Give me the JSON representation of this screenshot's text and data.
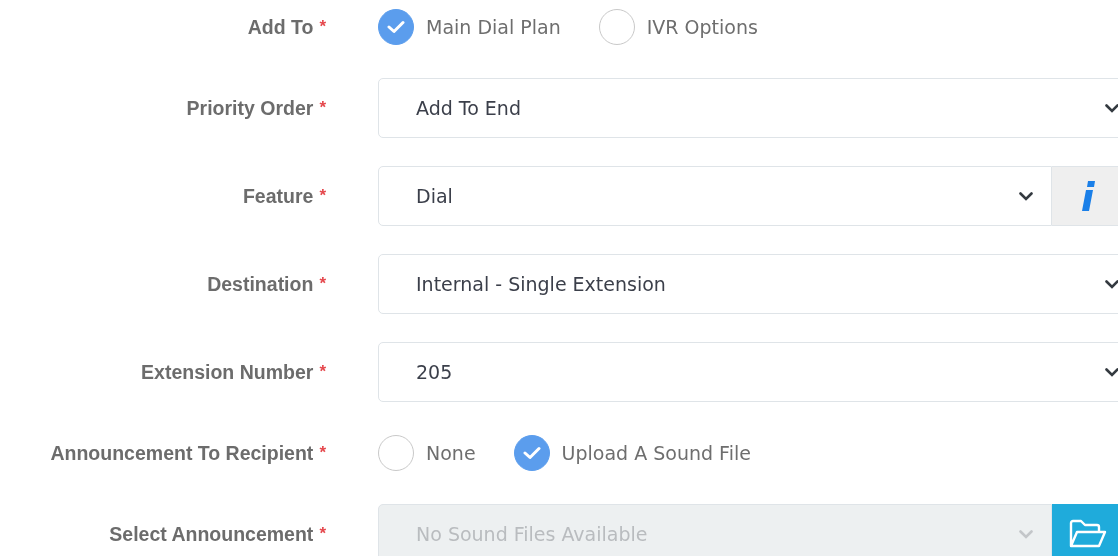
{
  "form": {
    "rows": [
      {
        "kind": "radio",
        "label": "Add To",
        "required_mark": "*",
        "options": [
          {
            "label": "Main Dial Plan",
            "selected": true
          },
          {
            "label": "IVR Options",
            "selected": false
          }
        ]
      },
      {
        "kind": "select",
        "label": "Priority Order",
        "required_mark": "*",
        "value": "Add To End",
        "disabled": false
      },
      {
        "kind": "select_info",
        "label": "Feature",
        "required_mark": "*",
        "value": "Dial",
        "disabled": false
      },
      {
        "kind": "select",
        "label": "Destination",
        "required_mark": "*",
        "value": "Internal - Single Extension",
        "disabled": false
      },
      {
        "kind": "select",
        "label": "Extension Number",
        "required_mark": "*",
        "value": "205",
        "disabled": false
      },
      {
        "kind": "radio",
        "label": "Announcement To Recipient",
        "required_mark": "*",
        "options": [
          {
            "label": "None",
            "selected": false
          },
          {
            "label": "Upload A Sound File",
            "selected": true
          }
        ]
      },
      {
        "kind": "select_file",
        "label": "Select Announcement",
        "required_mark": "*",
        "value": "No Sound Files Available",
        "disabled": true
      }
    ]
  }
}
